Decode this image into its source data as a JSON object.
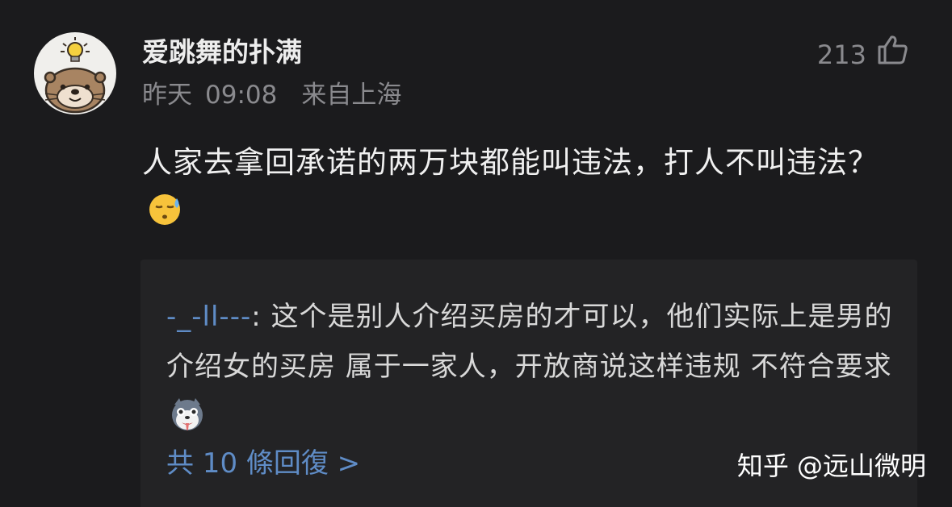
{
  "comment": {
    "username": "爱跳舞的扑满",
    "date_label": "昨天",
    "time": "09:08",
    "location": "来自上海",
    "likes": "213",
    "content": "人家去拿回承诺的两万块都能叫违法，打人不叫违法？",
    "content_emoji": "sweat-face-emoji",
    "avatar_icon": "otter-lightbulb-avatar",
    "like_icon": "thumbs-up-icon"
  },
  "reply": {
    "author": "-_-ll---",
    "separator": ": ",
    "text": "这个是别人介绍买房的才可以，他们实际上是男的介绍女的买房  属于一家人，开放商说这样违规 不符合要求",
    "emoji": "husky-emoji",
    "count_label": "共 10 條回復 >"
  },
  "watermark": "知乎 @远山微明",
  "colors": {
    "background": "#1b1b1d",
    "reply_background": "#232325",
    "link_blue": "#5f8cc6",
    "meta_gray": "#8a8a8e"
  }
}
